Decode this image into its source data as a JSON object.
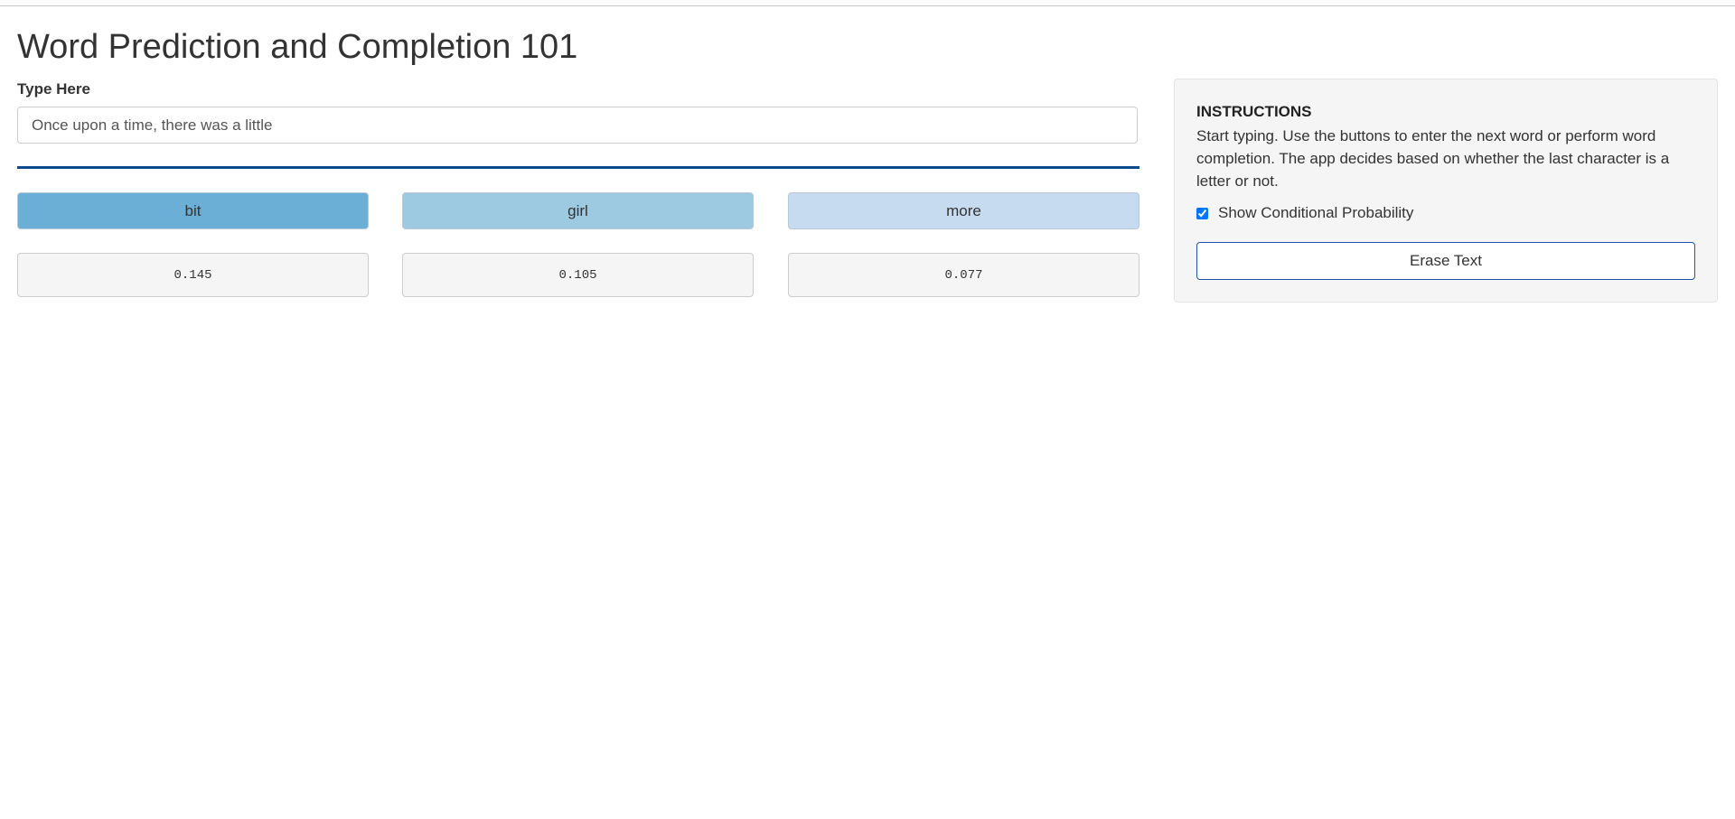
{
  "page": {
    "title": "Word Prediction and Completion 101"
  },
  "input": {
    "label": "Type Here",
    "value": "Once upon a time, there was a little"
  },
  "predictions": [
    {
      "word": "bit",
      "probability": "0.145",
      "color": "#6baed6"
    },
    {
      "word": "girl",
      "probability": "0.105",
      "color": "#9ecae1"
    },
    {
      "word": "more",
      "probability": "0.077",
      "color": "#c6dbef"
    }
  ],
  "instructions": {
    "title": "INSTRUCTIONS",
    "text": "Start typing. Use the buttons to enter the next word or perform word completion. The app decides based on whether the last character is a letter or not.",
    "checkbox_label": "Show Conditional Probability",
    "checkbox_checked": true,
    "erase_label": "Erase Text"
  },
  "colors": {
    "divider": "#0b4a8c",
    "erase_border": "#1a56a8",
    "panel_bg": "#f5f5f5"
  }
}
